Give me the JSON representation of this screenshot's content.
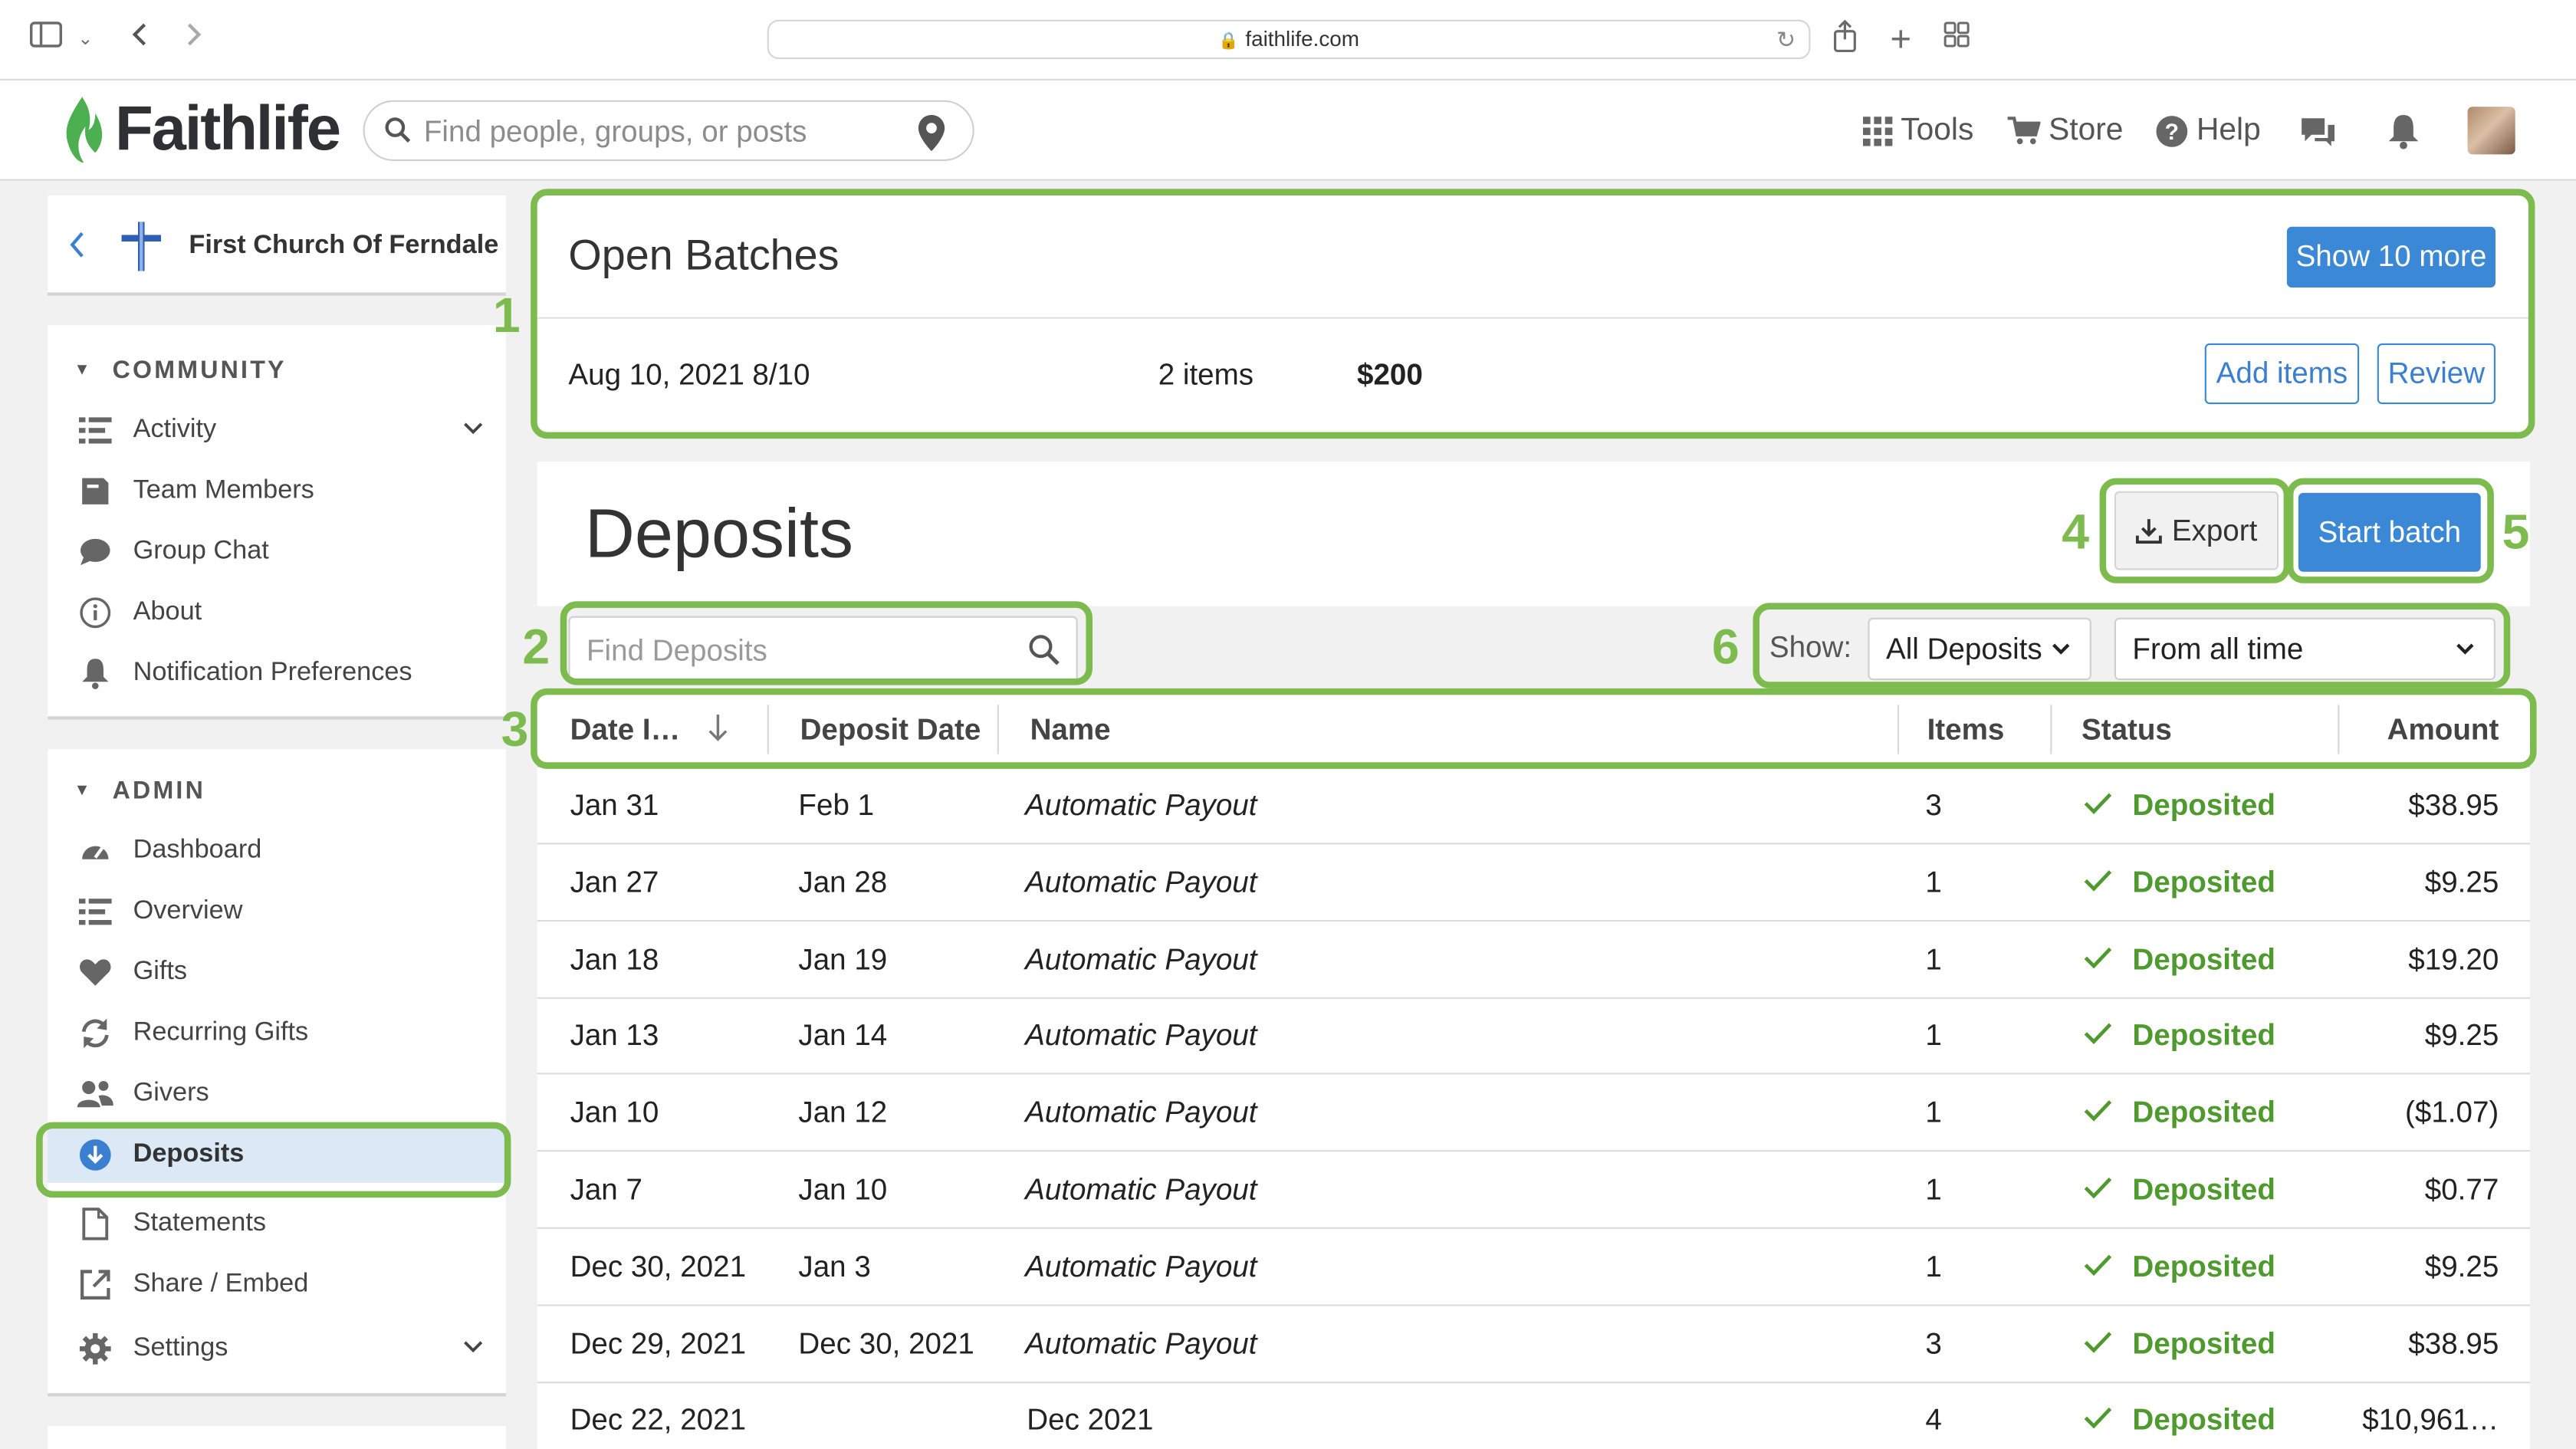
{
  "browser": {
    "url": "faithlife.com",
    "icons": [
      "sidebar-icon",
      "chevron-down-icon",
      "back-arrow-icon",
      "forward-arrow-icon",
      "lock-icon",
      "reload-icon",
      "share-icon",
      "new-tab-icon",
      "tab-overview-icon"
    ]
  },
  "header": {
    "logo_text": "Faithlife",
    "search_placeholder": "Find people, groups, or posts",
    "nav": {
      "tools": "Tools",
      "store": "Store",
      "help": "Help"
    }
  },
  "sidebar": {
    "church_name": "First Church Of Ferndale",
    "community": {
      "heading": "COMMUNITY",
      "items": [
        {
          "label": "Activity",
          "icon": "list-icon"
        },
        {
          "label": "Team Members",
          "icon": "badge-icon"
        },
        {
          "label": "Group Chat",
          "icon": "chat-icon"
        },
        {
          "label": "About",
          "icon": "info-icon"
        },
        {
          "label": "Notification Preferences",
          "icon": "bell-icon"
        }
      ]
    },
    "admin": {
      "heading": "ADMIN",
      "items": [
        {
          "label": "Dashboard",
          "icon": "gauge-icon"
        },
        {
          "label": "Overview",
          "icon": "list-icon"
        },
        {
          "label": "Gifts",
          "icon": "heart-icon"
        },
        {
          "label": "Recurring Gifts",
          "icon": "recurring-icon"
        },
        {
          "label": "Givers",
          "icon": "people-icon"
        },
        {
          "label": "Deposits",
          "icon": "download-circle-icon",
          "active": true
        },
        {
          "label": "Statements",
          "icon": "document-icon"
        },
        {
          "label": "Share / Embed",
          "icon": "external-link-icon"
        },
        {
          "label": "Settings",
          "icon": "gear-icon"
        }
      ]
    }
  },
  "open_batches": {
    "title": "Open Batches",
    "show_more": "Show 10 more",
    "batch": {
      "date": "Aug 10, 2021",
      "name": "8/10",
      "items": "2 items",
      "amount": "$200",
      "add_items": "Add items",
      "review": "Review"
    }
  },
  "deposits": {
    "title": "Deposits",
    "export_label": "Export",
    "start_batch_label": "Start batch",
    "search_placeholder": "Find Deposits",
    "show_label": "Show:",
    "filter_type": "All Deposits",
    "filter_range": "From all time",
    "columns": [
      "Date I…",
      "Deposit Date",
      "Name",
      "Items",
      "Status",
      "Amount"
    ],
    "rows": [
      {
        "date_initiated": "Jan 31",
        "deposit_date": "Feb 1",
        "name": "Automatic Payout",
        "italic": true,
        "items": "3",
        "status": "Deposited",
        "amount": "$38.95"
      },
      {
        "date_initiated": "Jan 27",
        "deposit_date": "Jan 28",
        "name": "Automatic Payout",
        "italic": true,
        "items": "1",
        "status": "Deposited",
        "amount": "$9.25"
      },
      {
        "date_initiated": "Jan 18",
        "deposit_date": "Jan 19",
        "name": "Automatic Payout",
        "italic": true,
        "items": "1",
        "status": "Deposited",
        "amount": "$19.20"
      },
      {
        "date_initiated": "Jan 13",
        "deposit_date": "Jan 14",
        "name": "Automatic Payout",
        "italic": true,
        "items": "1",
        "status": "Deposited",
        "amount": "$9.25"
      },
      {
        "date_initiated": "Jan 10",
        "deposit_date": "Jan 12",
        "name": "Automatic Payout",
        "italic": true,
        "items": "1",
        "status": "Deposited",
        "amount": "($1.07)"
      },
      {
        "date_initiated": "Jan 7",
        "deposit_date": "Jan 10",
        "name": "Automatic Payout",
        "italic": true,
        "items": "1",
        "status": "Deposited",
        "amount": "$0.77"
      },
      {
        "date_initiated": "Dec 30, 2021",
        "deposit_date": "Jan 3",
        "name": "Automatic Payout",
        "italic": true,
        "items": "1",
        "status": "Deposited",
        "amount": "$9.25"
      },
      {
        "date_initiated": "Dec 29, 2021",
        "deposit_date": "Dec 30, 2021",
        "name": "Automatic Payout",
        "italic": true,
        "items": "3",
        "status": "Deposited",
        "amount": "$38.95"
      },
      {
        "date_initiated": "Dec 22, 2021",
        "deposit_date": "",
        "name": "Dec 2021",
        "italic": false,
        "items": "4",
        "status": "Deposited",
        "amount": "$10,961…"
      }
    ]
  },
  "annotations": [
    "1",
    "2",
    "3",
    "4",
    "5",
    "6"
  ],
  "colors": {
    "accent": "#3b88d6",
    "brand_green": "#4caf50",
    "status_green": "#4e9a2e",
    "annotation_green": "#7dbb4e",
    "active_bg": "#dbe9f7"
  }
}
